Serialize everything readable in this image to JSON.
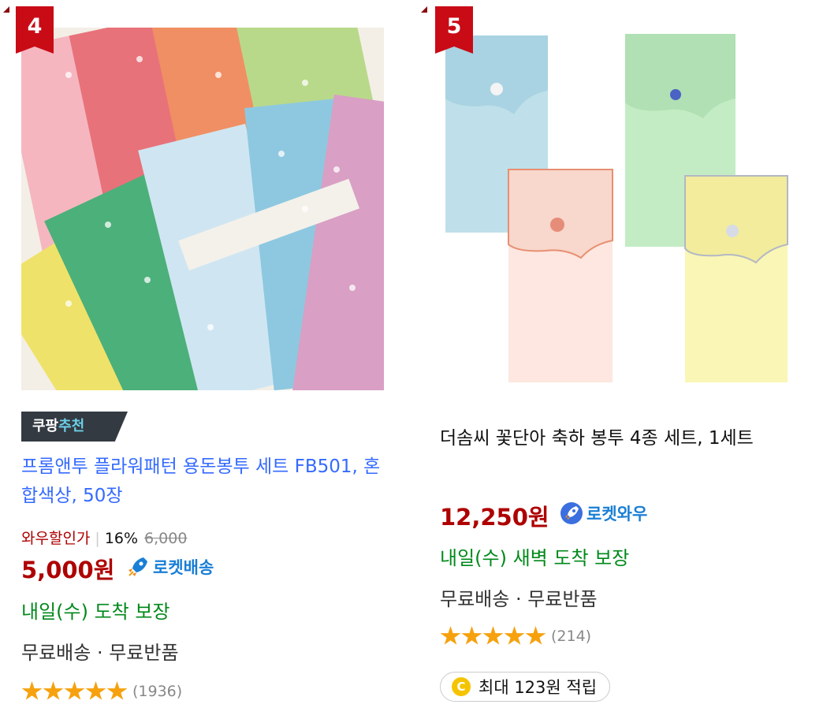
{
  "products": [
    {
      "rank": "4",
      "badge": {
        "prefix": "쿠팡",
        "highlight": "추천"
      },
      "title": "프롬앤투 플라워패턴 용돈봉투 세트 FB501, 혼합색상, 50장",
      "discount": {
        "label": "와우할인가",
        "percent": "16%",
        "original": "6,000"
      },
      "price": "5,000원",
      "delivery_tag": "로켓배송",
      "arrival": "내일(수) 도착 보장",
      "shipping": "무료배송 · 무료반품",
      "rating": {
        "stars": 5,
        "count": "(1936)"
      }
    },
    {
      "rank": "5",
      "title": "더솜씨 꽃단아 축하 봉투 4종 세트, 1세트",
      "price": "12,250원",
      "delivery_tag": "로켓와우",
      "arrival": "내일(수) 새벽 도착 보장",
      "shipping": "무료배송 · 무료반품",
      "rating": {
        "stars": 5,
        "count": "(214)"
      },
      "reward": {
        "coin": "C",
        "text": "최대 123원 적립"
      }
    }
  ],
  "colors": {
    "rank_bg": "#c90b16",
    "price": "#ae0000",
    "link_title": "#346aff",
    "arrival": "#00891a",
    "star": "#f6a10d",
    "rocket": "#1a7fd6"
  },
  "icons": [
    "rocket-icon",
    "star-icon",
    "coin-icon"
  ]
}
